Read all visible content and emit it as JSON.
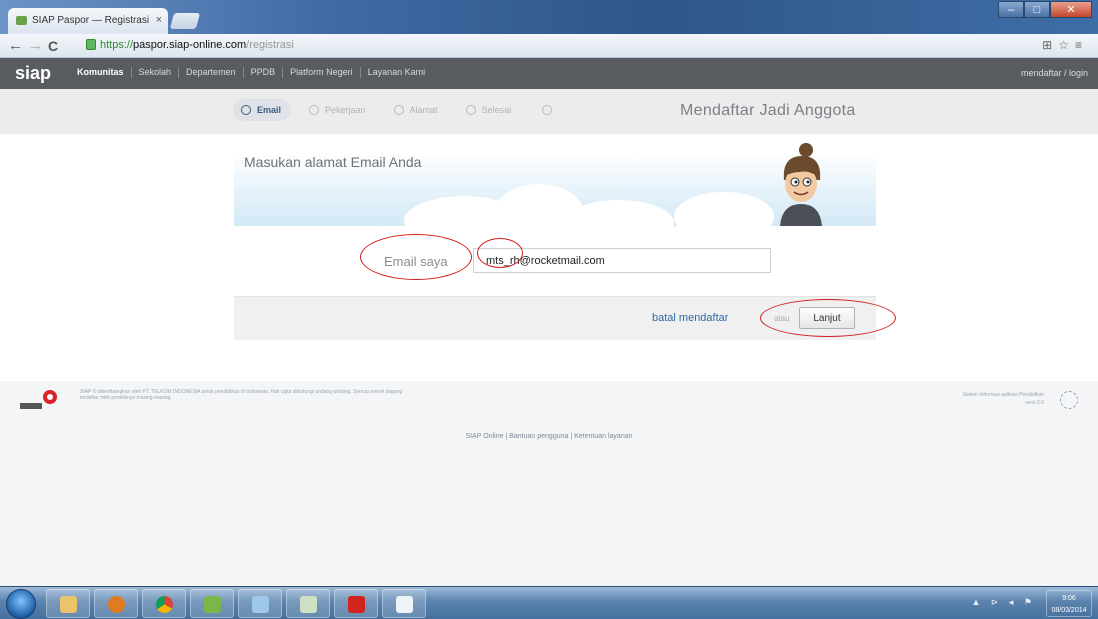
{
  "browser": {
    "tab_title": "SIAP Paspor — Registrasi",
    "tab_close": "×",
    "url_scheme": "https://",
    "url_host": "paspor.siap-online.com",
    "url_path": "/registrasi",
    "window_minimize": "–",
    "window_maximize": "□",
    "window_close": "✕",
    "back": "←",
    "forward": "→",
    "reload": "C",
    "toolbar_icons": "⊞☆≡"
  },
  "site_nav": {
    "logo": "siap",
    "items": [
      "Komunitas",
      "Sekolah",
      "Departemen",
      "PPDB",
      "Platform Negeri",
      "Layanan Kami"
    ],
    "user_link": "mendaftar / login"
  },
  "steps": {
    "items": [
      "Email",
      "Pekerjaan",
      "Alamat",
      "Selesai",
      ""
    ],
    "title": "Mendaftar Jadi Anggota"
  },
  "form": {
    "heading": "Masukan alamat Email Anda",
    "email_label": "Email saya",
    "email_value": "mts_rh@rocketmail.com",
    "cancel_label": "batal mendaftar",
    "or_label": "atau",
    "next_label": "Lanjut"
  },
  "footer": {
    "copyright": "SIAP © dikembangkan oleh PT. TELKOM INDONESIA untuk pendidikan di Indonesia. Hak cipta dilindungi undang-undang. Semua merek dagang terdaftar milik pemiliknya masing-masing.",
    "right_text": "Sistem Informasi aplikasi Pendidikan",
    "version": "versi 2.0",
    "links": [
      "SIAP Online",
      "Bantuan pengguna",
      "Ketentuan layanan"
    ]
  },
  "taskbar": {
    "tray": "▲ ⊳ ◂ ⚑",
    "time": "9:06",
    "date": "08/03/2014"
  }
}
